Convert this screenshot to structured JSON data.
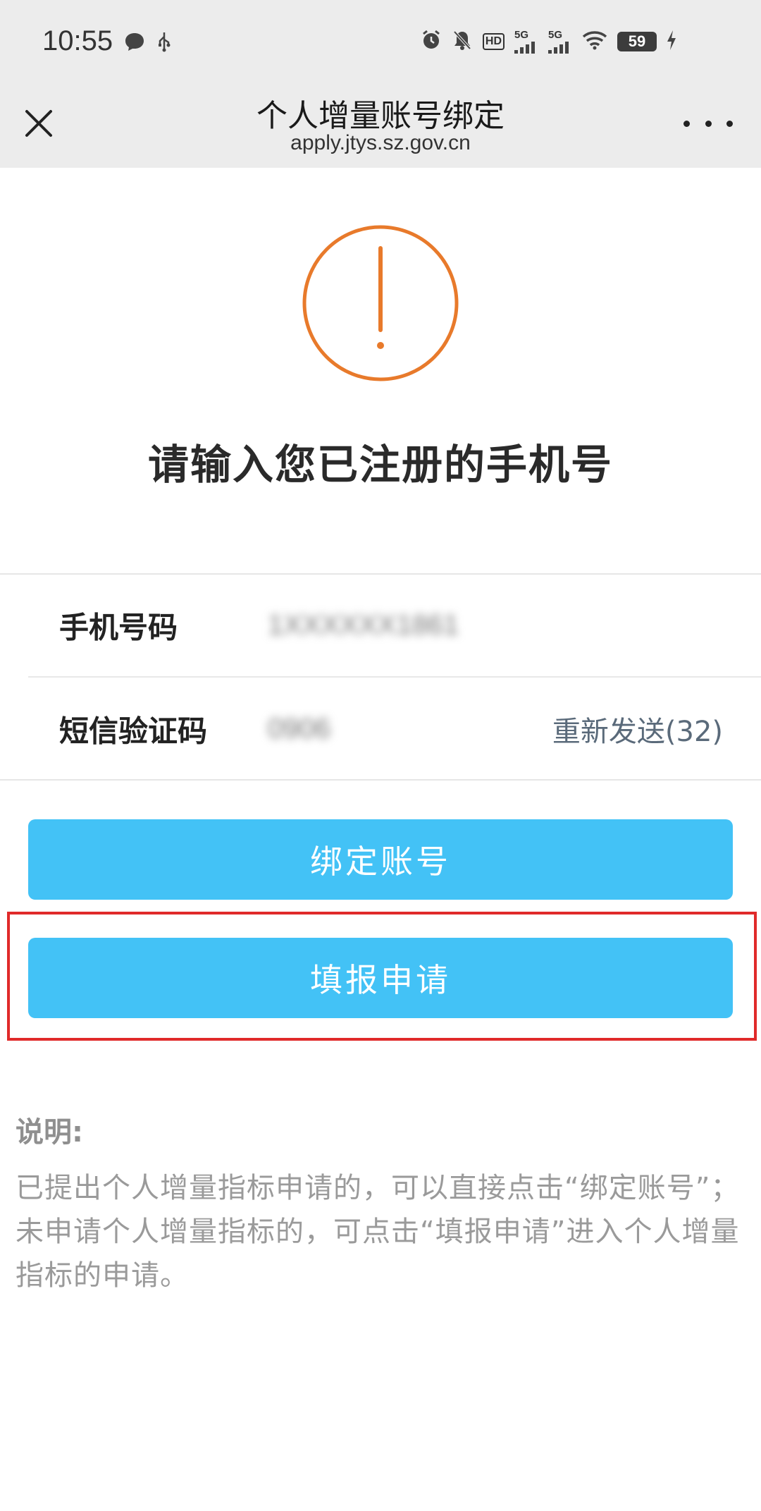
{
  "status_bar": {
    "time": "10:55",
    "signal_1": "5G",
    "signal_2": "5G",
    "hd_label": "HD",
    "battery": "59",
    "icons": [
      "chat-bubble-icon",
      "usb-icon",
      "alarm-icon",
      "bell-off-icon",
      "hd-icon",
      "signal-icon",
      "wifi-icon",
      "battery-icon",
      "charging-icon"
    ]
  },
  "header": {
    "title": "个人增量账号绑定",
    "url": "apply.jtys.sz.gov.cn",
    "close_icon": "close-icon",
    "more_icon": "more-icon"
  },
  "hero": {
    "icon": "exclamation-circle-icon",
    "accent_color": "#e87a2b",
    "headline": "请输入您已注册的手机号"
  },
  "form": {
    "phone_label": "手机号码",
    "phone_value": "1XXXXXX1861",
    "sms_label": "短信验证码",
    "sms_value": "0906",
    "resend_label": "重新发送(32)"
  },
  "actions": {
    "bind_label": "绑定账号",
    "apply_label": "填报申请",
    "button_color": "#43c2f6",
    "highlight_color": "#e02a2a"
  },
  "note": {
    "title": "说明:",
    "body": "已提出个人增量指标申请的，可以直接点击“绑定账号”；未申请个人增量指标的，可点击“填报申请”进入个人增量指标的申请。"
  }
}
